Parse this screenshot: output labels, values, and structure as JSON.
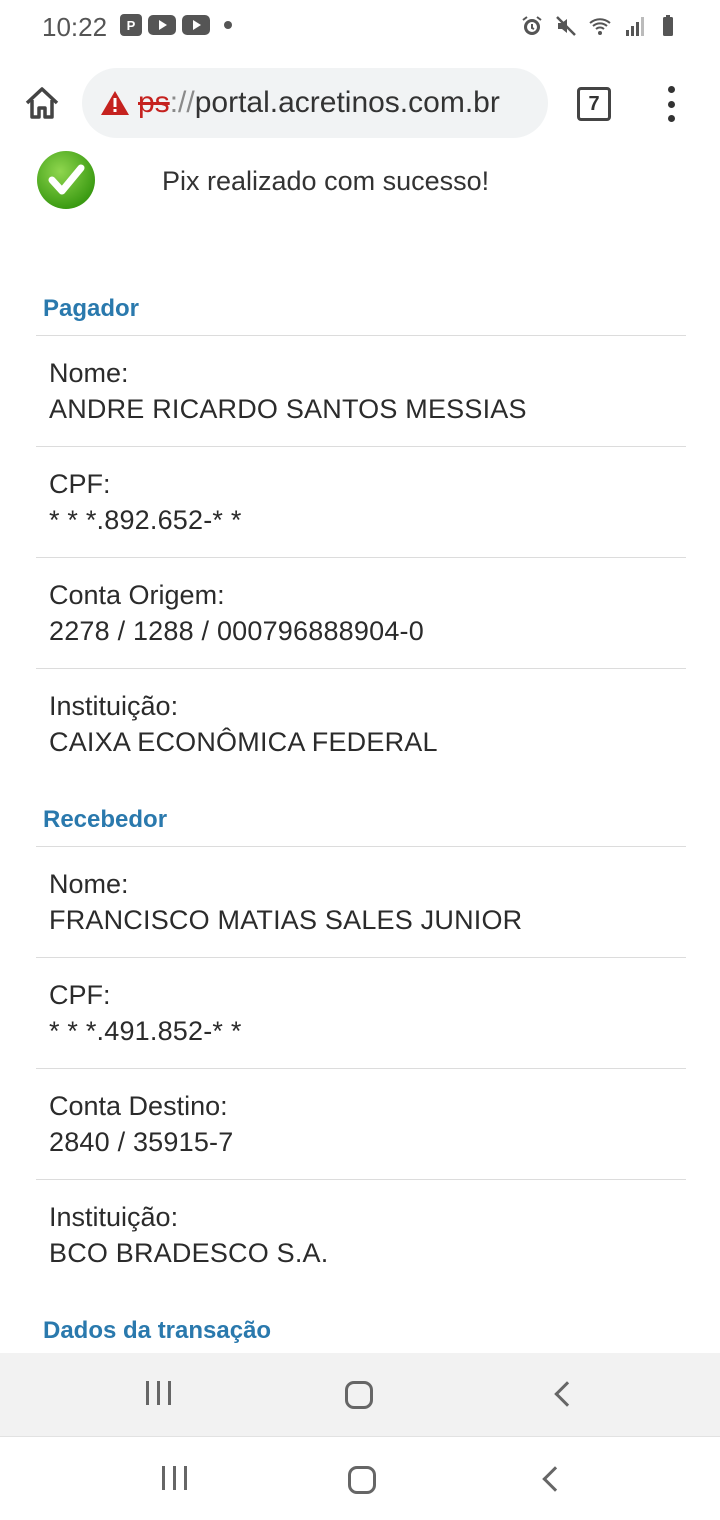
{
  "status_bar": {
    "time": "10:22",
    "left_icons": [
      "parking-icon",
      "youtube-icon",
      "youtube-icon",
      "dot-icon"
    ],
    "right_icons": [
      "alarm-icon",
      "mute-icon",
      "wifi-icon",
      "signal-icon",
      "battery-icon"
    ]
  },
  "browser": {
    "url_scheme": "ps",
    "url_separator": "://",
    "url_host": "portal.acretinos.com.br",
    "tab_count": "7"
  },
  "receipt": {
    "success_message": "Pix realizado com sucesso!",
    "payer": {
      "title": "Pagador",
      "fields": [
        {
          "label": "Nome:",
          "value": "ANDRE RICARDO SANTOS MESSIAS"
        },
        {
          "label": "CPF:",
          "value": "* * *.892.652-* *"
        },
        {
          "label": "Conta Origem:",
          "value": "2278 / 1288 / 000796888904-0"
        },
        {
          "label": "Instituição:",
          "value": "CAIXA ECONÔMICA FEDERAL"
        }
      ]
    },
    "receiver": {
      "title": "Recebedor",
      "fields": [
        {
          "label": "Nome:",
          "value": "FRANCISCO MATIAS SALES JUNIOR"
        },
        {
          "label": "CPF:",
          "value": "* * *.491.852-* *"
        },
        {
          "label": "Conta Destino:",
          "value": "2840 / 35915-7"
        },
        {
          "label": "Instituição:",
          "value": "BCO BRADESCO S.A."
        }
      ]
    },
    "transaction_title": "Dados da transação"
  },
  "colors": {
    "section_title": "#2a79ad",
    "success_green": "#4caf1e",
    "warning_red": "#c5221f"
  }
}
